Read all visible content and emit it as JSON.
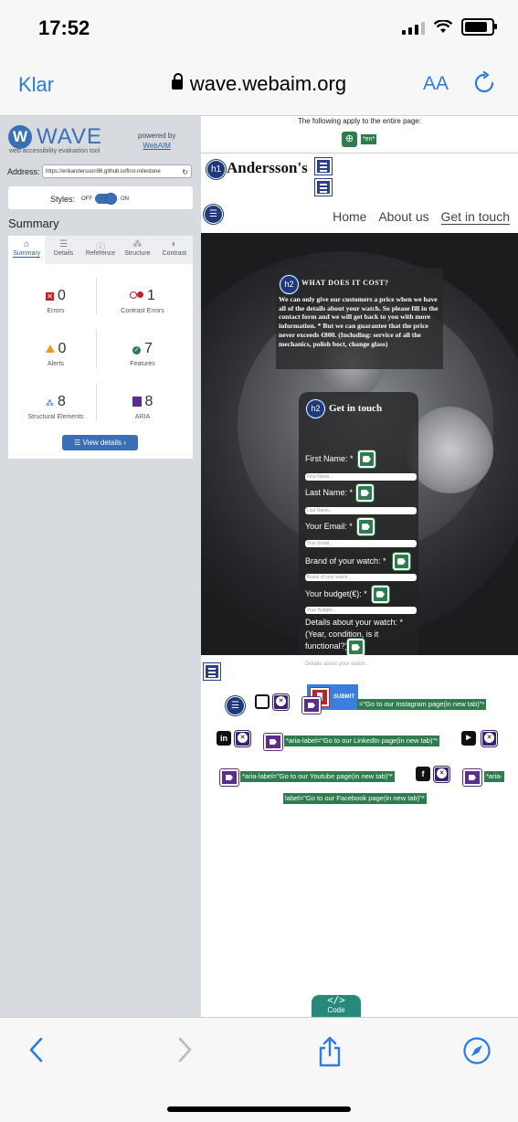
{
  "status": {
    "time": "17:52"
  },
  "browser": {
    "done_label": "Klar",
    "url": "wave.webaim.org",
    "text_size_label": "AA"
  },
  "wave": {
    "logo": "WAVE",
    "logo_letter": "W",
    "tagline": "web accessibility evaluation tool",
    "powered_by": "powered by",
    "powered_link": "WebAIM",
    "address_label": "Address:",
    "address_value": "https://erikandersson96.github.io/first-milestone",
    "styles_label": "Styles:",
    "styles_off": "OFF",
    "styles_on": "ON",
    "styles_state": "on",
    "summary_title": "Summary",
    "tabs": [
      {
        "label": "Summary",
        "icon": "home-icon"
      },
      {
        "label": "Details",
        "icon": "list-icon"
      },
      {
        "label": "Reference",
        "icon": "info-icon"
      },
      {
        "label": "Structure",
        "icon": "structure-icon"
      },
      {
        "label": "Contrast",
        "icon": "contrast-icon"
      }
    ],
    "stats": {
      "errors": {
        "count": "0",
        "label": "Errors"
      },
      "contrast_errors": {
        "count": "1",
        "label": "Contrast Errors"
      },
      "alerts": {
        "count": "0",
        "label": "Alerts"
      },
      "features": {
        "count": "7",
        "label": "Features"
      },
      "structural": {
        "count": "8",
        "label": "Structural Elements"
      },
      "aria": {
        "count": "8",
        "label": "ARIA"
      }
    },
    "view_details": "View details ›",
    "colors": {
      "brand": "#3b6fb5",
      "error": "#c8202a",
      "alert": "#e6a121",
      "feature": "#2e7d4f",
      "aria": "#5b2d8e"
    }
  },
  "preview": {
    "applies_text": "The following apply to the entire page:",
    "lang_tag": "*en*",
    "h1_marker": "h1",
    "h2_marker": "h2",
    "brand": "Andersson's",
    "nav": [
      "Home",
      "About us",
      "Get in touch"
    ],
    "cost_title": "WHAT DOES IT COST?",
    "cost_text": "We can only give our customers a price when we have all of the details about your watch. So please fill in the contact form and we will get back to you with more information. * But we can guarantee that the price never exceeds €800. (Including: service of all the mechanics, polish boct, change glass)",
    "form_title": "Get in touch",
    "fields": [
      {
        "label": "First Name: *",
        "placeholder": "First Name..."
      },
      {
        "label": "Last Name: *",
        "placeholder": "Last Name..."
      },
      {
        "label": "Your Email: *",
        "placeholder": "Your Email..."
      },
      {
        "label": "Brand of your watch: *",
        "placeholder": "Brand of your watch..."
      },
      {
        "label": "Your budget(€): *",
        "placeholder": "Your Budget..."
      }
    ],
    "details_label": "Details about your watch: * (Year, condition, is it functional?)",
    "details_placeholder": "Details about your watch...",
    "submit_label": "SUBMIT",
    "aria_labels": {
      "instagram": "=\"Go to our Instagram page(in new tab)\"*",
      "linkedin": "*aria-label=\"Go to our LinkedIn page(in new tab)\"*",
      "youtube": "*aria-label=\"Go to our Youtube page(in new tab)\"*",
      "facebook_a": "*aria-",
      "facebook_b": "label=\"Go to our Facebook page(in new tab)\"*"
    },
    "social_glyphs": {
      "linkedin": "in",
      "facebook": "f"
    },
    "code_label": "Code",
    "code_icon": "</>"
  }
}
